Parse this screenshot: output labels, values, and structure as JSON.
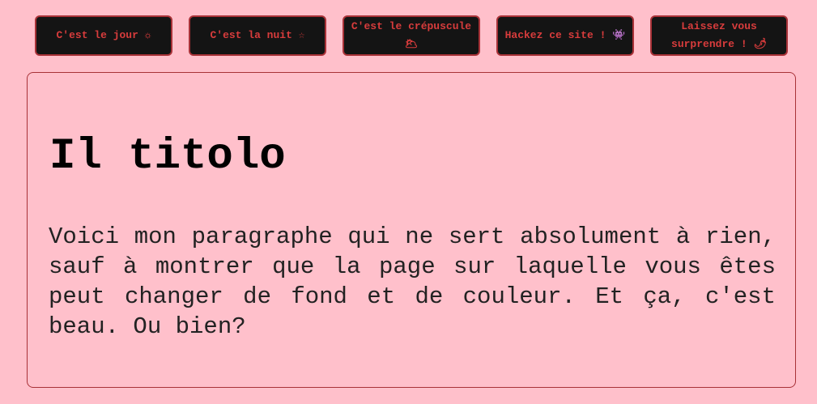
{
  "toolbar": {
    "buttons": [
      {
        "label": "C'est le jour ☼"
      },
      {
        "label": "C'est la nuit ☆"
      },
      {
        "label": "C'est le crépuscule 🌥"
      },
      {
        "label": "Hackez ce site ! 👾"
      },
      {
        "label": "Laissez vous surprendre ! 🌶"
      }
    ]
  },
  "main": {
    "title": "Il titolo",
    "paragraph": "Voici mon paragraphe qui ne sert absolument à rien, sauf à montrer que la page sur laquelle vous êtes peut changer de fond et de couleur. Et ça, c'est beau. Ou bien?"
  },
  "colors": {
    "background": "#ffc0cb",
    "button_background": "#141414",
    "button_text": "#d83c3c",
    "border": "#a83238"
  }
}
